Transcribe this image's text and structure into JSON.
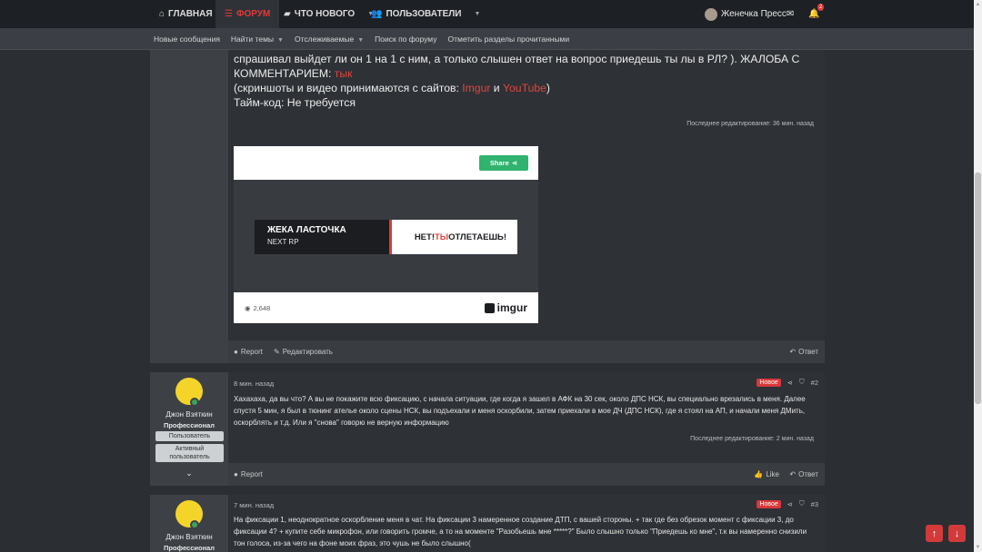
{
  "nav": {
    "tabs": [
      {
        "icon": "home-icon",
        "label": "ГЛАВНАЯ"
      },
      {
        "icon": "forum-icon",
        "label": "ФОРУМ"
      },
      {
        "icon": "chat-icon",
        "label": "ЧТО НОВОГО"
      },
      {
        "icon": "users-icon",
        "label": "ПОЛЬЗОВАТЕЛИ"
      }
    ],
    "username": "Женечка Пресс",
    "alerts_count": "2"
  },
  "subnav": {
    "items": [
      "Новые сообщения",
      "Найти темы",
      "Отслеживаемые",
      "Поиск по форуму",
      "Отметить разделы прочитанными"
    ]
  },
  "post1": {
    "line1": "спрашивал выйдет ли он 1 на 1 с ним, а только слышен ответ на вопрос приедешь ты лы в РЛ? ). ЖАЛОБА С",
    "line2_prefix": "КОММЕНТАРИЕМ: ",
    "line2_link": "тык",
    "line3_prefix": "(скриншоты и видео принимаются с сайтов: ",
    "link_imgur": "Imgur",
    "and_word": " и ",
    "link_youtube": "YouTube",
    "line3_suffix": ")",
    "line4": "Тайм-код: Не требуется",
    "edited": "Последнее редактирование: 36 мин. назад",
    "embed": {
      "share": "Share",
      "banner_title": "ЖЕКА ЛАСТОЧКА",
      "banner_sub": "NEXT RP",
      "banner_right_1": "НЕТ! ",
      "banner_right_2": "ТЫ",
      "banner_right_3": " ОТЛЕТАЕШЬ!",
      "views": "2,648",
      "brand": "imgur"
    },
    "report": "Report",
    "edit": "Редактировать",
    "reply": "Ответ"
  },
  "post2": {
    "username": "Джон Взяткин",
    "title": "Профессионал",
    "badge1": "Пользователь",
    "badge2": "Активный пользователь",
    "time": "8 мин. назад",
    "new_label": "Новое",
    "number": "#2",
    "text": "Хахахаха, да вы что? А вы не покажите всю фиксацию, с начала ситуации, где когда я зашел в АФК на 30 сек, около ДПС НСК, вы специально врезались в меня. Далее спустя 5 мин, я был в тюнинг ателье около сцены НСК, вы подъехали и меня оскорбили, затем приехали в мое ДЧ (ДПС НСК), где я стоял на АП, и начали меня ДМить, оскорблять и т.д. Или я \"снова\" говорю не верную информацию",
    "edited": "Последнее редактирование: 2 мин. назад",
    "report": "Report",
    "like": "Like",
    "reply": "Ответ"
  },
  "post3": {
    "username": "Джон Взяткин",
    "title": "Профессионал",
    "time": "7 мин. назад",
    "new_label": "Новое",
    "number": "#3",
    "text": "На фиксации 1, неоднократное оскорбление меня в чат. На фиксации 3 намеренное создание ДТП, с вашей стороны. + так где без обрезок момент с фиксации 3, до фиксации 4? + купите себе микрофон, или говорить громче, а то на моменте \"Разобьешь мне *****?\" Было слышно только \"Приедешь ко мне\", т.к вы намеренно снизили тон голоса, из-за чего на фоне моих фраз, это чушь не было слышно("
  },
  "colors": {
    "accent": "#e03a3a",
    "nav_bg": "#1d2024",
    "subnav_bg": "#3b3f45",
    "page_bg": "#2b2e33",
    "avatar": "#f5d42a"
  }
}
